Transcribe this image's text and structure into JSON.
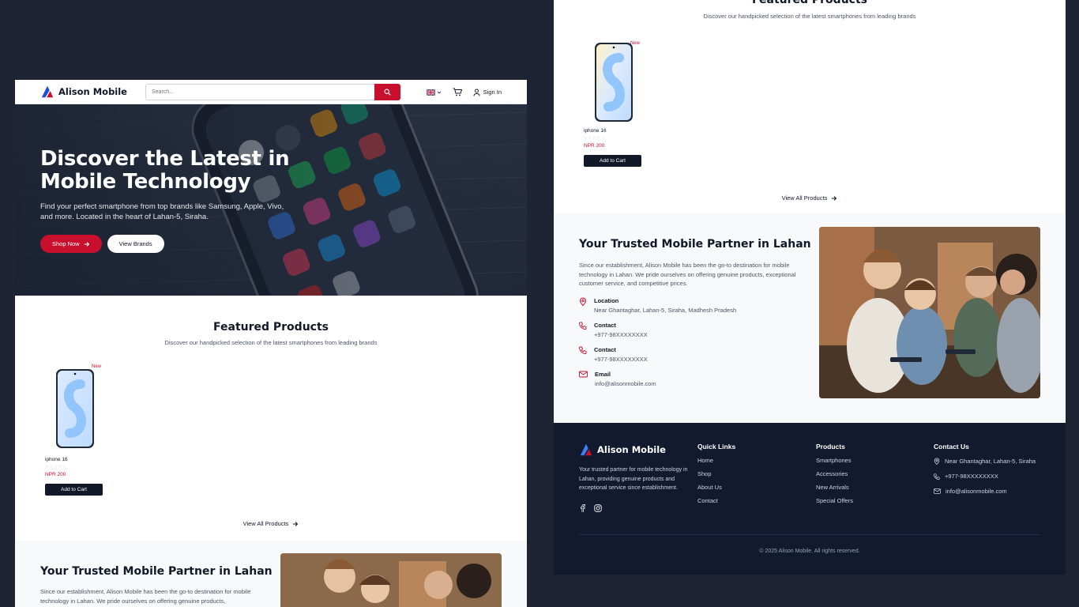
{
  "brand": {
    "name": "Alison Mobile"
  },
  "header": {
    "search_placeholder": "Search...",
    "signin": "Sign In"
  },
  "hero": {
    "title": "Discover the Latest in Mobile Technology",
    "subtitle": "Find your perfect smartphone from top brands like Samsung, Apple, Vivo, and more. Located in the heart of Lahan-5, Siraha.",
    "shop_now": "Shop Now",
    "view_brands": "View Brands"
  },
  "featured": {
    "title": "Featured Products",
    "subtitle": "Discover our handpicked selection of the latest smartphones from leading brands",
    "view_all": "View All Products",
    "products": [
      {
        "name": "iphone 16",
        "badge": "New",
        "stars": "☆☆☆☆☆",
        "price": "NPR 200",
        "button": "Add to Cart"
      }
    ]
  },
  "trusted": {
    "title": "Your Trusted Mobile Partner in Lahan",
    "desc": "Since our establishment, Alison Mobile has been the go-to destination for mobile technology in Lahan. We pride ourselves on offering genuine products, exceptional customer service, and competitive prices.",
    "desc_short": "Since our establishment, Alison Mobile has been the go-to destination for mobile technology in Lahan. We pride ourselves on offering genuine products,",
    "items": [
      {
        "label": "Location",
        "value": "Near Ghantaghar, Lahan-5, Siraha, Madhesh Pradesh"
      },
      {
        "label": "Contact",
        "value": "+977-98XXXXXXXX"
      },
      {
        "label": "Contact",
        "value": "+977-98XXXXXXXX"
      },
      {
        "label": "Email",
        "value": "info@alisonmobile.com"
      }
    ]
  },
  "footer": {
    "tagline": "Your trusted partner for mobile technology in Lahan, providing genuine products and exceptional service since establishment.",
    "quick_links": {
      "title": "Quick Links",
      "items": [
        "Home",
        "Shop",
        "About Us",
        "Contact"
      ]
    },
    "products": {
      "title": "Products",
      "items": [
        "Smartphones",
        "Accessories",
        "New Arrivals",
        "Special Offers"
      ]
    },
    "contact": {
      "title": "Contact Us",
      "address": "Near Ghantaghar, Lahan-5, Siraha",
      "phone": "+977-98XXXXXXXX",
      "email": "info@alisonmobile.com"
    },
    "copyright": "© 2025 Alison Mobile. All rights reserved."
  },
  "colors": {
    "brand_red": "#c8102e",
    "dark": "#111827",
    "footer_bg": "#111a2e",
    "page_bg": "#1e2433"
  },
  "icons": [
    "search-icon",
    "uk-flag-icon",
    "chevron-down-icon",
    "cart-icon",
    "user-icon",
    "arrow-right-icon",
    "location-icon",
    "phone-icon",
    "mail-icon",
    "facebook-icon",
    "instagram-icon"
  ]
}
